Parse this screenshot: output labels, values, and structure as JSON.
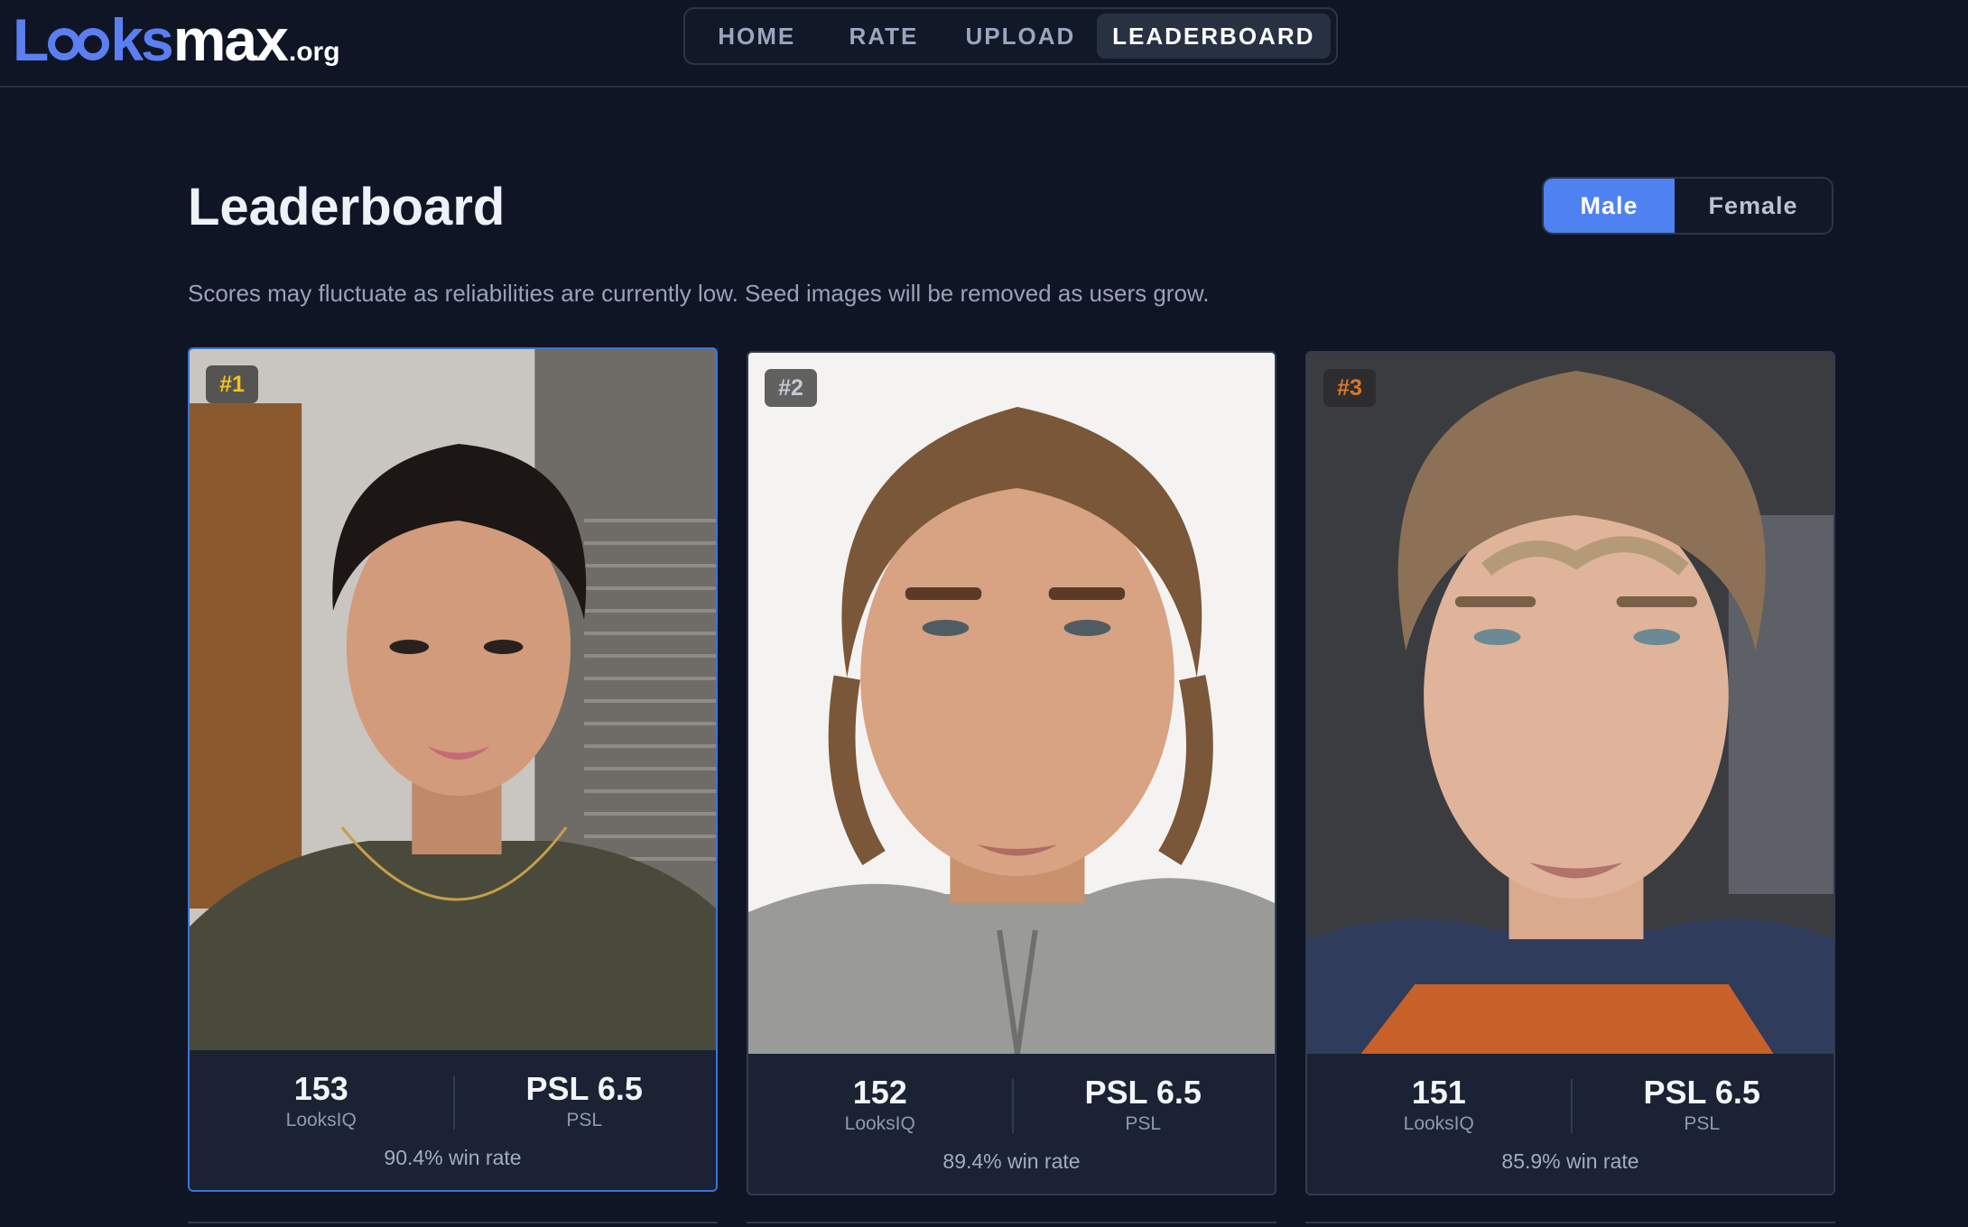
{
  "logo": {
    "part1": "L",
    "part2": "ks",
    "part3": "max",
    "suffix": ".org",
    "full": "Looksmax.org"
  },
  "nav": {
    "items": [
      {
        "label": "HOME",
        "active": false
      },
      {
        "label": "RATE",
        "active": false
      },
      {
        "label": "UPLOAD",
        "active": false
      },
      {
        "label": "LEADERBOARD",
        "active": true
      }
    ]
  },
  "page": {
    "title": "Leaderboard",
    "subtitle": "Scores may fluctuate as reliabilities are currently low. Seed images will be removed as users grow."
  },
  "gender_toggle": {
    "options": [
      "Male",
      "Female"
    ],
    "selected": "Male"
  },
  "cards": [
    {
      "rank": "#1",
      "rank_color": "#f2c21b",
      "score": "153",
      "score_label": "LooksIQ",
      "psl": "PSL 6.5",
      "psl_label": "PSL",
      "win_rate": "90.4% win rate",
      "photo_desc": "person-photo"
    },
    {
      "rank": "#2",
      "rank_color": "#c4c9d4",
      "score": "152",
      "score_label": "LooksIQ",
      "psl": "PSL 6.5",
      "psl_label": "PSL",
      "win_rate": "89.4% win rate",
      "photo_desc": "person-photo"
    },
    {
      "rank": "#3",
      "rank_color": "#d77a2a",
      "score": "151",
      "score_label": "LooksIQ",
      "psl": "PSL 6.5",
      "psl_label": "PSL",
      "win_rate": "85.9% win rate",
      "photo_desc": "person-photo"
    }
  ],
  "colors": {
    "accent": "#4d82f0",
    "background": "#0f1525",
    "card": "#1a2233",
    "logo_blue": "#5b7ff0"
  }
}
